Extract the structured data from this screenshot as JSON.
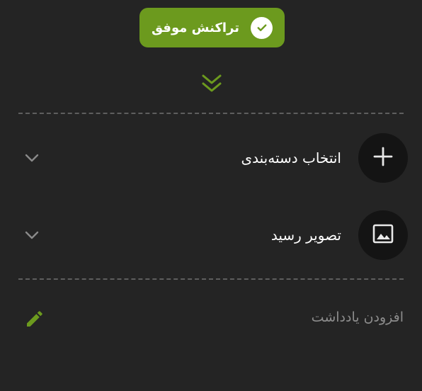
{
  "colors": {
    "background": "#242424",
    "accent": "#6c9a1e",
    "icon_circle": "#141414",
    "divider": "#5e5e5e"
  },
  "status_badge": {
    "label": "تراکنش موفق",
    "icon": "check-circle-icon"
  },
  "expand_toggle": {
    "icon": "double-chevron-down-icon"
  },
  "rows": [
    {
      "label": "انتخاب دسته‌بندی",
      "icon": "plus-icon",
      "trailing_icon": "chevron-down-icon"
    },
    {
      "label": "تصویر رسید",
      "icon": "image-icon",
      "trailing_icon": "chevron-down-icon"
    }
  ],
  "note": {
    "placeholder": "افزودن یادداشت",
    "value": "",
    "icon": "pencil-icon"
  }
}
